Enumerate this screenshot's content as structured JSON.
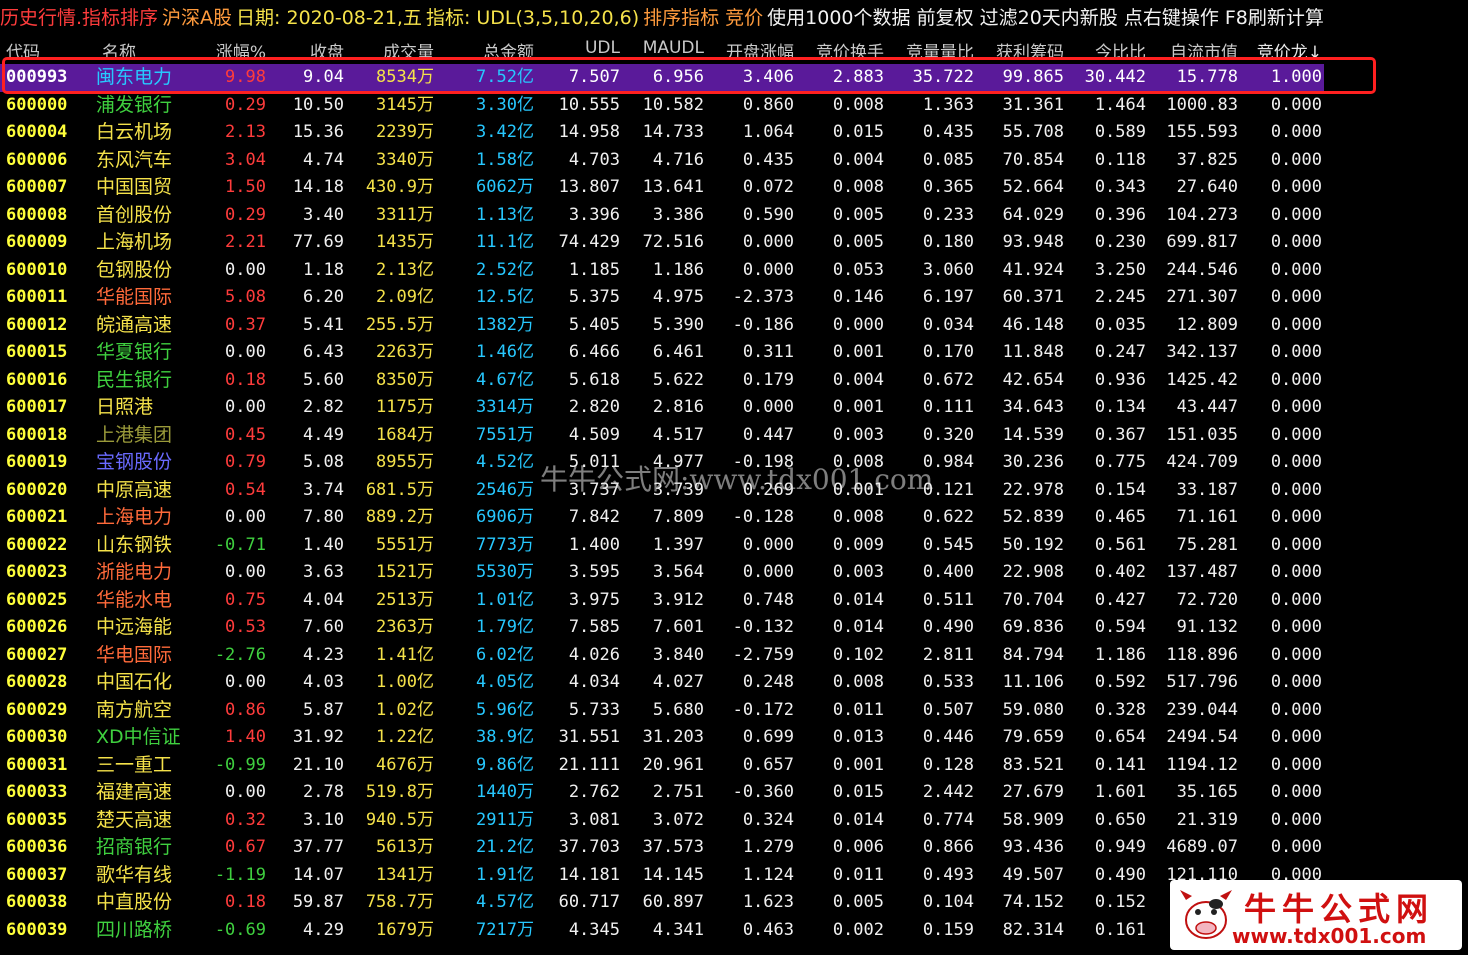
{
  "topbar": [
    {
      "text": "历史行情.指标排序",
      "cls": "t-red"
    },
    {
      "text": "沪深A股",
      "cls": "t-orange"
    },
    {
      "text": "日期: 2020-08-21,五",
      "cls": "t-yellow"
    },
    {
      "text": "指标: UDL(3,5,10,20,6)",
      "cls": "t-yellow"
    },
    {
      "text": "排序指标 竞价",
      "cls": "t-orange"
    },
    {
      "text": "使用1000个数据 前复权 过滤20天内新股 点右键操作 F8刷新计算",
      "cls": "t-white"
    }
  ],
  "columns": [
    "代码",
    "名称",
    "涨幅%",
    "收盘",
    "成交量",
    "总金额",
    "UDL",
    "MAUDL",
    "开盘涨幅",
    "竞价换手",
    "竞量量比",
    "获利筹码",
    "今比比",
    "自流市值",
    "竞价龙↓"
  ],
  "rows": [
    [
      "000993",
      "闽东电力",
      "9.98",
      "9.04",
      "8534万",
      "7.52亿",
      "7.507",
      "6.956",
      "3.406",
      "2.883",
      "35.722",
      "99.865",
      "30.442",
      "15.778",
      "1.000",
      "red",
      "#27c8ff",
      true
    ],
    [
      "600000",
      "浦发银行",
      "0.29",
      "10.50",
      "3145万",
      "3.30亿",
      "10.555",
      "10.582",
      "0.860",
      "0.008",
      "1.363",
      "31.361",
      "1.464",
      "1000.83",
      "0.000",
      "red",
      "#3fd03f",
      false
    ],
    [
      "600004",
      "白云机场",
      "2.13",
      "15.36",
      "2239万",
      "3.42亿",
      "14.958",
      "14.733",
      "1.064",
      "0.015",
      "0.435",
      "55.708",
      "0.589",
      "155.593",
      "0.000",
      "red",
      "#f5e24a",
      false
    ],
    [
      "600006",
      "东风汽车",
      "3.04",
      "4.74",
      "3340万",
      "1.58亿",
      "4.703",
      "4.716",
      "0.435",
      "0.004",
      "0.085",
      "70.854",
      "0.118",
      "37.825",
      "0.000",
      "red",
      "#f5e24a",
      false
    ],
    [
      "600007",
      "中国国贸",
      "1.50",
      "14.18",
      "430.9万",
      "6062万",
      "13.807",
      "13.641",
      "0.072",
      "0.008",
      "0.365",
      "52.664",
      "0.343",
      "27.640",
      "0.000",
      "red",
      "#f5e24a",
      false
    ],
    [
      "600008",
      "首创股份",
      "0.29",
      "3.40",
      "3311万",
      "1.13亿",
      "3.396",
      "3.386",
      "0.590",
      "0.005",
      "0.233",
      "64.029",
      "0.396",
      "104.273",
      "0.000",
      "red",
      "#f5e24a",
      false
    ],
    [
      "600009",
      "上海机场",
      "2.21",
      "77.69",
      "1435万",
      "11.1亿",
      "74.429",
      "72.516",
      "0.000",
      "0.005",
      "0.180",
      "93.948",
      "0.230",
      "699.817",
      "0.000",
      "red",
      "#f5e24a",
      false
    ],
    [
      "600010",
      "包钢股份",
      "0.00",
      "1.18",
      "2.13亿",
      "2.52亿",
      "1.185",
      "1.186",
      "0.000",
      "0.053",
      "3.060",
      "41.924",
      "3.250",
      "244.546",
      "0.000",
      "white",
      "#f5e24a",
      false
    ],
    [
      "600011",
      "华能国际",
      "5.08",
      "6.20",
      "2.09亿",
      "12.5亿",
      "5.375",
      "4.975",
      "-2.373",
      "0.146",
      "6.197",
      "60.371",
      "2.245",
      "271.307",
      "0.000",
      "red",
      "#ff6a3a",
      false
    ],
    [
      "600012",
      "皖通高速",
      "0.37",
      "5.41",
      "255.5万",
      "1382万",
      "5.405",
      "5.390",
      "-0.186",
      "0.000",
      "0.034",
      "46.148",
      "0.035",
      "12.809",
      "0.000",
      "red",
      "#f5e24a",
      false
    ],
    [
      "600015",
      "华夏银行",
      "0.00",
      "6.43",
      "2263万",
      "1.46亿",
      "6.466",
      "6.461",
      "0.311",
      "0.001",
      "0.170",
      "11.848",
      "0.247",
      "342.137",
      "0.000",
      "white",
      "#3fd03f",
      false
    ],
    [
      "600016",
      "民生银行",
      "0.18",
      "5.60",
      "8350万",
      "4.67亿",
      "5.618",
      "5.622",
      "0.179",
      "0.004",
      "0.672",
      "42.654",
      "0.936",
      "1425.42",
      "0.000",
      "red",
      "#3fd03f",
      false
    ],
    [
      "600017",
      "日照港",
      "0.00",
      "2.82",
      "1175万",
      "3314万",
      "2.820",
      "2.816",
      "0.000",
      "0.001",
      "0.111",
      "34.643",
      "0.134",
      "43.447",
      "0.000",
      "white",
      "#f5e24a",
      false
    ],
    [
      "600018",
      "上港集团",
      "0.45",
      "4.49",
      "1684万",
      "7551万",
      "4.509",
      "4.517",
      "0.447",
      "0.003",
      "0.320",
      "14.539",
      "0.367",
      "151.035",
      "0.000",
      "red",
      "#9a9a3a",
      false
    ],
    [
      "600019",
      "宝钢股份",
      "0.79",
      "5.08",
      "8955万",
      "4.52亿",
      "5.011",
      "4.977",
      "-0.198",
      "0.008",
      "0.984",
      "30.236",
      "0.775",
      "424.709",
      "0.000",
      "red",
      "#6a6aff",
      false
    ],
    [
      "600020",
      "中原高速",
      "0.54",
      "3.74",
      "681.5万",
      "2546万",
      "3.737",
      "3.739",
      "0.269",
      "0.001",
      "0.121",
      "22.978",
      "0.154",
      "33.187",
      "0.000",
      "red",
      "#f5e24a",
      false
    ],
    [
      "600021",
      "上海电力",
      "0.00",
      "7.80",
      "889.2万",
      "6906万",
      "7.842",
      "7.809",
      "-0.128",
      "0.008",
      "0.622",
      "52.839",
      "0.465",
      "71.161",
      "0.000",
      "white",
      "#ff6a3a",
      false
    ],
    [
      "600022",
      "山东钢铁",
      "-0.71",
      "1.40",
      "5551万",
      "7773万",
      "1.400",
      "1.397",
      "0.000",
      "0.009",
      "0.545",
      "50.192",
      "0.561",
      "75.281",
      "0.000",
      "green",
      "#f5e24a",
      false
    ],
    [
      "600023",
      "浙能电力",
      "0.00",
      "3.63",
      "1521万",
      "5530万",
      "3.595",
      "3.564",
      "0.000",
      "0.003",
      "0.400",
      "22.908",
      "0.402",
      "137.487",
      "0.000",
      "white",
      "#ff6a3a",
      false
    ],
    [
      "600025",
      "华能水电",
      "0.75",
      "4.04",
      "2513万",
      "1.01亿",
      "3.975",
      "3.912",
      "0.748",
      "0.014",
      "0.511",
      "70.704",
      "0.427",
      "72.720",
      "0.000",
      "red",
      "#ff6a3a",
      false
    ],
    [
      "600026",
      "中远海能",
      "0.53",
      "7.60",
      "2363万",
      "1.79亿",
      "7.585",
      "7.601",
      "-0.132",
      "0.014",
      "0.490",
      "69.836",
      "0.594",
      "91.132",
      "0.000",
      "red",
      "#f5e24a",
      false
    ],
    [
      "600027",
      "华电国际",
      "-2.76",
      "4.23",
      "1.41亿",
      "6.02亿",
      "4.026",
      "3.840",
      "-2.759",
      "0.102",
      "2.811",
      "84.794",
      "1.186",
      "118.896",
      "0.000",
      "green",
      "#ff6a3a",
      false
    ],
    [
      "600028",
      "中国石化",
      "0.00",
      "4.03",
      "1.00亿",
      "4.05亿",
      "4.034",
      "4.027",
      "0.248",
      "0.008",
      "0.533",
      "11.106",
      "0.592",
      "517.796",
      "0.000",
      "white",
      "#f5e24a",
      false
    ],
    [
      "600029",
      "南方航空",
      "0.86",
      "5.87",
      "1.02亿",
      "5.96亿",
      "5.733",
      "5.680",
      "-0.172",
      "0.011",
      "0.507",
      "59.080",
      "0.328",
      "239.044",
      "0.000",
      "red",
      "#f5e24a",
      false
    ],
    [
      "600030",
      "XD中信证",
      "1.40",
      "31.92",
      "1.22亿",
      "38.9亿",
      "31.551",
      "31.203",
      "0.699",
      "0.013",
      "0.446",
      "79.659",
      "0.654",
      "2494.54",
      "0.000",
      "red",
      "#3fd03f",
      false
    ],
    [
      "600031",
      "三一重工",
      "-0.99",
      "21.10",
      "4676万",
      "9.86亿",
      "21.111",
      "20.961",
      "0.657",
      "0.001",
      "0.128",
      "83.521",
      "0.141",
      "1194.12",
      "0.000",
      "green",
      "#f5e24a",
      false
    ],
    [
      "600033",
      "福建高速",
      "0.00",
      "2.78",
      "519.8万",
      "1440万",
      "2.762",
      "2.751",
      "-0.360",
      "0.015",
      "2.442",
      "27.679",
      "1.601",
      "35.165",
      "0.000",
      "white",
      "#f5e24a",
      false
    ],
    [
      "600035",
      "楚天高速",
      "0.32",
      "3.10",
      "940.5万",
      "2911万",
      "3.081",
      "3.072",
      "0.324",
      "0.014",
      "0.774",
      "58.909",
      "0.650",
      "21.319",
      "0.000",
      "red",
      "#f5e24a",
      false
    ],
    [
      "600036",
      "招商银行",
      "0.67",
      "37.77",
      "5613万",
      "21.2亿",
      "37.703",
      "37.573",
      "1.279",
      "0.006",
      "0.866",
      "93.436",
      "0.949",
      "4689.07",
      "0.000",
      "red",
      "#3fd03f",
      false
    ],
    [
      "600037",
      "歌华有线",
      "-1.19",
      "14.07",
      "1341万",
      "1.91亿",
      "14.181",
      "14.145",
      "1.124",
      "0.011",
      "0.493",
      "49.507",
      "0.490",
      "121.110",
      "0.000",
      "green",
      "#f5e24a",
      false
    ],
    [
      "600038",
      "中直股份",
      "0.18",
      "59.87",
      "758.7万",
      "4.57亿",
      "60.717",
      "60.897",
      "1.623",
      "0.005",
      "0.104",
      "74.152",
      "0.152",
      "",
      "",
      "red",
      "#f5e24a",
      false
    ],
    [
      "600039",
      "四川路桥",
      "-0.69",
      "4.29",
      "1679万",
      "7217万",
      "4.345",
      "4.341",
      "0.463",
      "0.002",
      "0.159",
      "82.314",
      "0.161",
      "",
      "",
      "green",
      "#3fd03f",
      false
    ]
  ],
  "watermark": "牛牛公式网:www.tdx001.com",
  "logo": {
    "title": "牛牛公式网",
    "url": "www.tdx001.com"
  }
}
